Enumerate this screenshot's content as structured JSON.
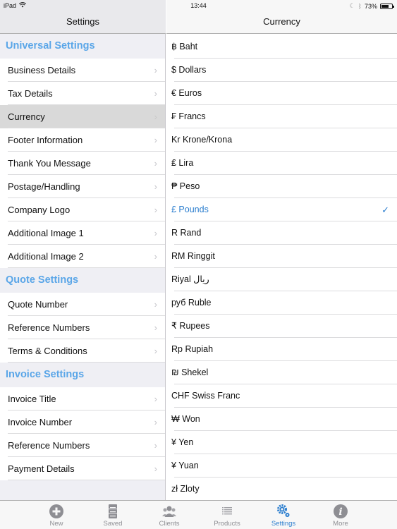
{
  "status_bar": {
    "device": "iPad",
    "time": "13:44",
    "battery_percent": "73%",
    "battery_level": 0.73
  },
  "master": {
    "title": "Settings",
    "sections": [
      {
        "header": "Universal Settings",
        "items": [
          {
            "label": "Business Details",
            "selected": false
          },
          {
            "label": "Tax Details",
            "selected": false
          },
          {
            "label": "Currency",
            "selected": true
          },
          {
            "label": "Footer Information",
            "selected": false
          },
          {
            "label": "Thank You Message",
            "selected": false
          },
          {
            "label": "Postage/Handling",
            "selected": false
          },
          {
            "label": "Company Logo",
            "selected": false
          },
          {
            "label": "Additional Image 1",
            "selected": false
          },
          {
            "label": "Additional Image 2",
            "selected": false
          }
        ]
      },
      {
        "header": "Quote Settings",
        "items": [
          {
            "label": "Quote Number",
            "selected": false
          },
          {
            "label": "Reference Numbers",
            "selected": false
          },
          {
            "label": "Terms & Conditions",
            "selected": false
          }
        ]
      },
      {
        "header": "Invoice Settings",
        "items": [
          {
            "label": "Invoice Title",
            "selected": false
          },
          {
            "label": "Invoice Number",
            "selected": false
          },
          {
            "label": "Reference Numbers",
            "selected": false
          },
          {
            "label": "Payment Details",
            "selected": false
          }
        ]
      }
    ]
  },
  "detail": {
    "title": "Currency",
    "selected_currency": "£ Pounds",
    "currencies": [
      "฿ Baht",
      "$ Dollars",
      "€ Euros",
      "₣ Francs",
      "Kr Krone/Krona",
      "₤ Lira",
      "₱ Peso",
      "£ Pounds",
      "R Rand",
      "RM Ringgit",
      "Riyal ريال",
      "руб Ruble",
      "₹ Rupees",
      "Rp Rupiah",
      "₪ Shekel",
      "CHF Swiss Franc",
      "₩ Won",
      "¥ Yen",
      "¥ Yuan",
      "zł Zloty"
    ]
  },
  "tab_bar": {
    "active": "Settings",
    "tabs": [
      {
        "label": "New",
        "icon": "plus-circle-icon"
      },
      {
        "label": "Saved",
        "icon": "cabinet-icon"
      },
      {
        "label": "Clients",
        "icon": "people-icon"
      },
      {
        "label": "Products",
        "icon": "list-icon"
      },
      {
        "label": "Settings",
        "icon": "gears-icon"
      },
      {
        "label": "More",
        "icon": "info-icon"
      }
    ]
  },
  "colors": {
    "accent": "#2d7fcf",
    "section_header": "#5aa6e8",
    "selected_cell": "#d9d9d9",
    "tab_inactive": "#8e8e93"
  }
}
